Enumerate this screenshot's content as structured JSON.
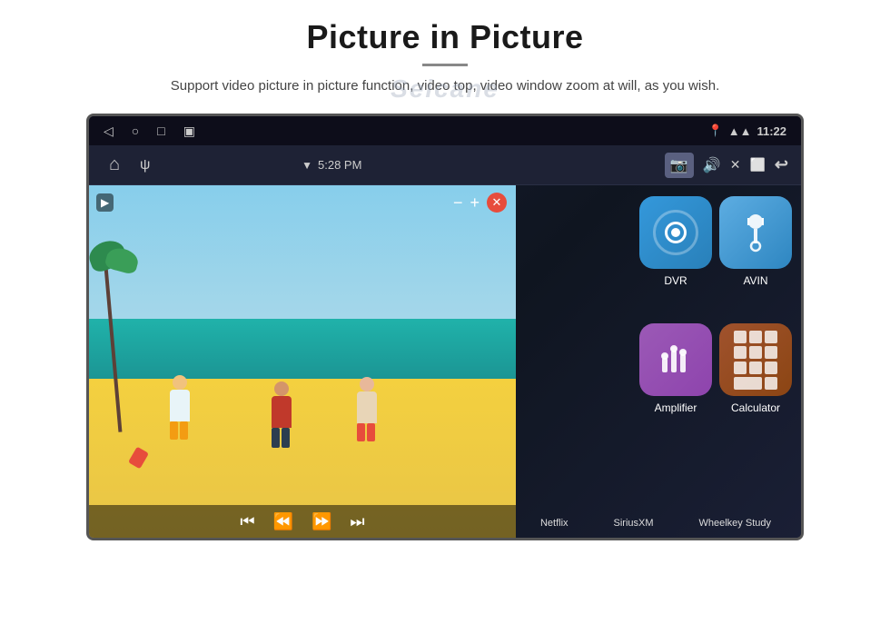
{
  "page": {
    "title": "Picture in Picture",
    "watermark": "Seicane",
    "subtitle": "Support video picture in picture function, video top, video window zoom at will, as you wish."
  },
  "device": {
    "statusBar": {
      "navButtons": [
        "◁",
        "○",
        "□",
        "⊡"
      ],
      "rightIcons": [
        "📍",
        "▼",
        "11:22"
      ]
    },
    "actionBar": {
      "leftIcons": [
        "⌂",
        "ψ"
      ],
      "rightIcons": [
        "📷",
        "🔊",
        "✕",
        "⬜",
        "↩"
      ],
      "time": "5:28 PM"
    }
  },
  "pip": {
    "controls": {
      "minimize": "−",
      "expand": "+",
      "close": "✕"
    },
    "mediaControls": [
      "⏮",
      "⏪",
      "⏩",
      "⏭"
    ]
  },
  "apps": {
    "row1_partial": [
      {
        "label": "",
        "color": "green"
      },
      {
        "label": "",
        "color": "pink"
      },
      {
        "label": "",
        "color": "purple"
      }
    ],
    "row1": [
      {
        "id": "dvr",
        "label": "DVR",
        "color": "dvr"
      },
      {
        "id": "avin",
        "label": "AVIN",
        "color": "avin"
      }
    ],
    "row2_partial": [
      {
        "label": "Netflix"
      },
      {
        "label": "SiriusXM"
      },
      {
        "label": "Wheelkey Study"
      }
    ],
    "row2": [
      {
        "id": "amplifier",
        "label": "Amplifier",
        "color": "amplifier"
      },
      {
        "id": "calculator",
        "label": "Calculator",
        "color": "calculator"
      }
    ]
  }
}
